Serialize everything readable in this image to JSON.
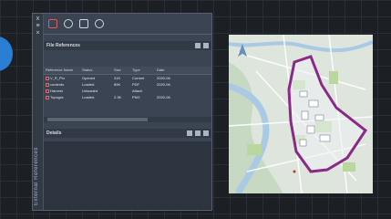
{
  "palette": {
    "title": "External References",
    "file_refs_label": "File References",
    "details_label": "Details",
    "strip_glyphs": [
      "x",
      "≡",
      "×"
    ],
    "columns": [
      "Reference Name",
      "Status",
      "Size",
      "Type",
      "Date"
    ],
    "rows": [
      {
        "name": "V_R_Plu",
        "status": "Opened",
        "size": "31K",
        "type": "Current",
        "date": "2020-06"
      },
      {
        "name": "contents",
        "status": "Loaded",
        "size": "89K",
        "type": "PDF",
        "date": "2020-06"
      },
      {
        "name": "Harvest",
        "status": "Unloaded",
        "size": "",
        "type": "Attach",
        "date": ""
      },
      {
        "name": "Topogra",
        "status": "Loaded",
        "size": "2.3K",
        "type": "PNG",
        "date": "2020-06"
      }
    ]
  },
  "map": {
    "boundary_color": "#8a2a86",
    "water_color": "#a9c9e4",
    "park_color": "#b9d79e"
  },
  "colors": {
    "accent_blue": "#2a7fd4",
    "panel_bg": "#3b4452"
  }
}
